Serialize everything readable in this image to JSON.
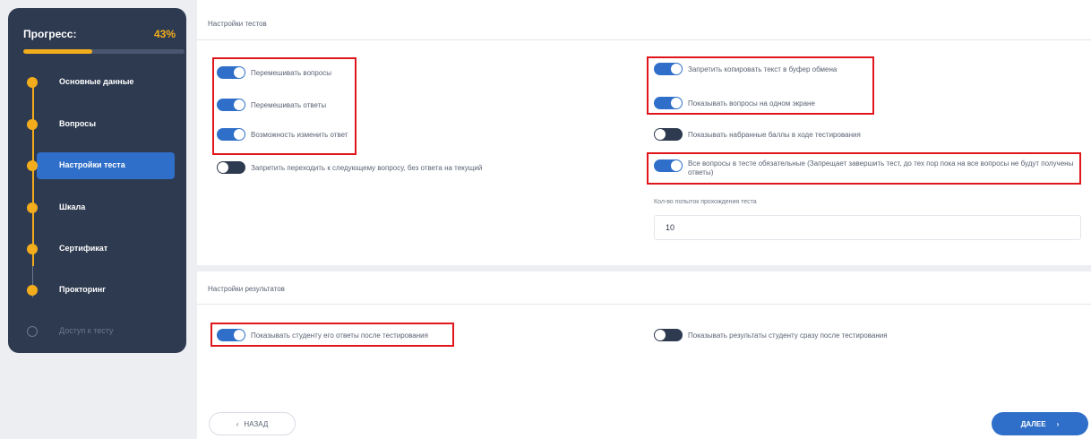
{
  "sidebar": {
    "progress_label": "Прогресс:",
    "progress_percent": "43%",
    "progress_value": 0.43,
    "accent_color": "#f3ad1c",
    "steps": [
      {
        "label": "Основные данные",
        "state": "done"
      },
      {
        "label": "Вопросы",
        "state": "done"
      },
      {
        "label": "Настройки теста",
        "state": "active"
      },
      {
        "label": "Шкала",
        "state": "done"
      },
      {
        "label": "Сертификат",
        "state": "done"
      },
      {
        "label": "Прокторинг",
        "state": "done"
      },
      {
        "label": "Доступ к тесту",
        "state": "disabled"
      }
    ]
  },
  "test_settings": {
    "title": "Настройки тестов",
    "left_toggles": [
      {
        "label": "Перемешивать вопросы",
        "on": true
      },
      {
        "label": "Перемешивать ответы",
        "on": true
      },
      {
        "label": "Возможность изменить ответ",
        "on": true
      },
      {
        "label": "Запретить переходить к следующему вопросу, без ответа на текущий",
        "on": false
      }
    ],
    "right_toggles": [
      {
        "label": "Запретить копировать текст в буфер обмена",
        "on": true
      },
      {
        "label": "Показывать вопросы на одном экране",
        "on": true
      },
      {
        "label": "Показывать набранные баллы в ходе тестирования",
        "on": false
      },
      {
        "label": "Все вопросы в тесте обязательные (Запрещает завершить тест, до тех пор пока на все вопросы не будут получены ответы)",
        "on": true
      }
    ],
    "attempts_label": "Кол-во попыток прохождения теста",
    "attempts_value": "10"
  },
  "result_settings": {
    "title": "Настройки результатов",
    "left_toggle": {
      "label": "Показывать студенту его ответы после тестирования",
      "on": true
    },
    "right_toggle": {
      "label": "Показывать результаты студенту сразу после тестирования",
      "on": false
    }
  },
  "footer": {
    "back_label": "НАЗАД",
    "back_icon": "chevron-left-icon",
    "next_label": "ДАЛЕЕ",
    "next_icon": "chevron-right-icon"
  },
  "colors": {
    "primary": "#2f6fc9",
    "sidebar_bg": "#2e3a50",
    "highlight": "#e0161c"
  }
}
